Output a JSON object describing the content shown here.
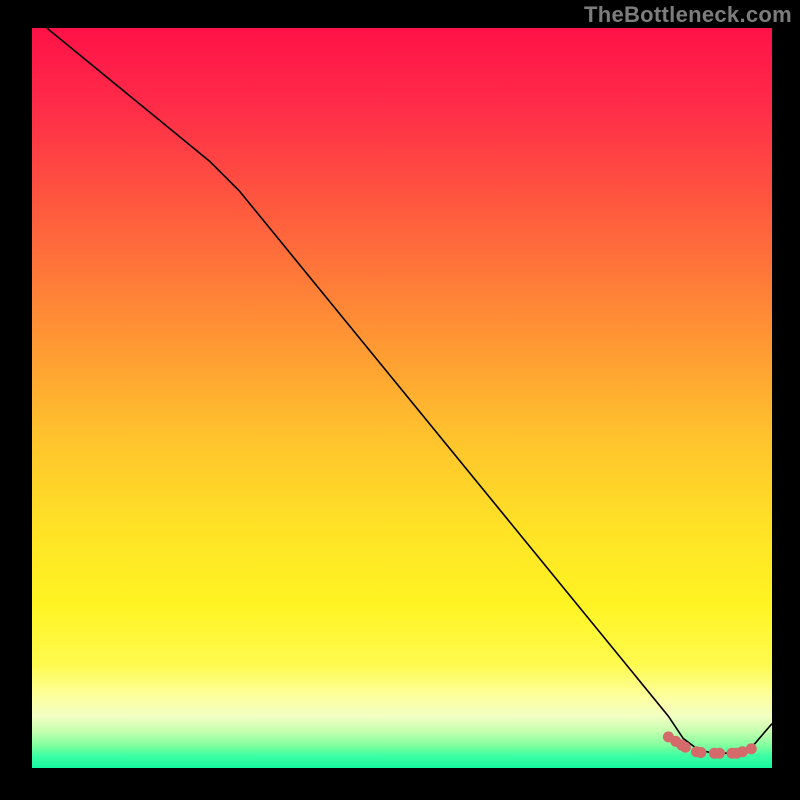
{
  "watermark": "TheBottleneck.com",
  "chart_data": {
    "type": "line",
    "title": "",
    "xlabel": "",
    "ylabel": "",
    "xlim": [
      0,
      100
    ],
    "ylim": [
      0,
      100
    ],
    "grid": false,
    "series": [
      {
        "name": "curve",
        "points": [
          {
            "x": 2,
            "y": 100
          },
          {
            "x": 24,
            "y": 82
          },
          {
            "x": 28,
            "y": 78
          },
          {
            "x": 86,
            "y": 7
          },
          {
            "x": 88,
            "y": 4
          },
          {
            "x": 90,
            "y": 2.5
          },
          {
            "x": 92,
            "y": 2
          },
          {
            "x": 95,
            "y": 2
          },
          {
            "x": 97,
            "y": 2.5
          },
          {
            "x": 100,
            "y": 6
          }
        ],
        "color": "#000000",
        "width": 1.6
      }
    ],
    "markers": {
      "name": "dots-near-trough",
      "color": "#d46a6a",
      "radius": 5.5,
      "points": [
        {
          "x": 86.0,
          "y": 4.2
        },
        {
          "x": 87.0,
          "y": 3.6
        },
        {
          "x": 87.8,
          "y": 3.1
        },
        {
          "x": 88.3,
          "y": 2.8
        },
        {
          "x": 89.8,
          "y": 2.2
        },
        {
          "x": 90.4,
          "y": 2.1
        },
        {
          "x": 92.2,
          "y": 2.0
        },
        {
          "x": 92.9,
          "y": 2.0
        },
        {
          "x": 94.6,
          "y": 2.0
        },
        {
          "x": 95.2,
          "y": 2.0
        },
        {
          "x": 96.0,
          "y": 2.2
        },
        {
          "x": 97.2,
          "y": 2.6
        }
      ]
    },
    "gradient_stops": [
      {
        "pos": 0,
        "color": "#ff1247"
      },
      {
        "pos": 0.1,
        "color": "#ff2a49"
      },
      {
        "pos": 0.25,
        "color": "#ff5c3e"
      },
      {
        "pos": 0.4,
        "color": "#ff8f35"
      },
      {
        "pos": 0.55,
        "color": "#ffc22d"
      },
      {
        "pos": 0.68,
        "color": "#ffe326"
      },
      {
        "pos": 0.78,
        "color": "#fff423"
      },
      {
        "pos": 0.86,
        "color": "#fffb4f"
      },
      {
        "pos": 0.905,
        "color": "#fdffa0"
      },
      {
        "pos": 0.93,
        "color": "#f2ffc3"
      },
      {
        "pos": 0.95,
        "color": "#c6ffb0"
      },
      {
        "pos": 0.97,
        "color": "#7fff9e"
      },
      {
        "pos": 0.983,
        "color": "#3effa2"
      },
      {
        "pos": 1.0,
        "color": "#14f7a0"
      }
    ]
  }
}
